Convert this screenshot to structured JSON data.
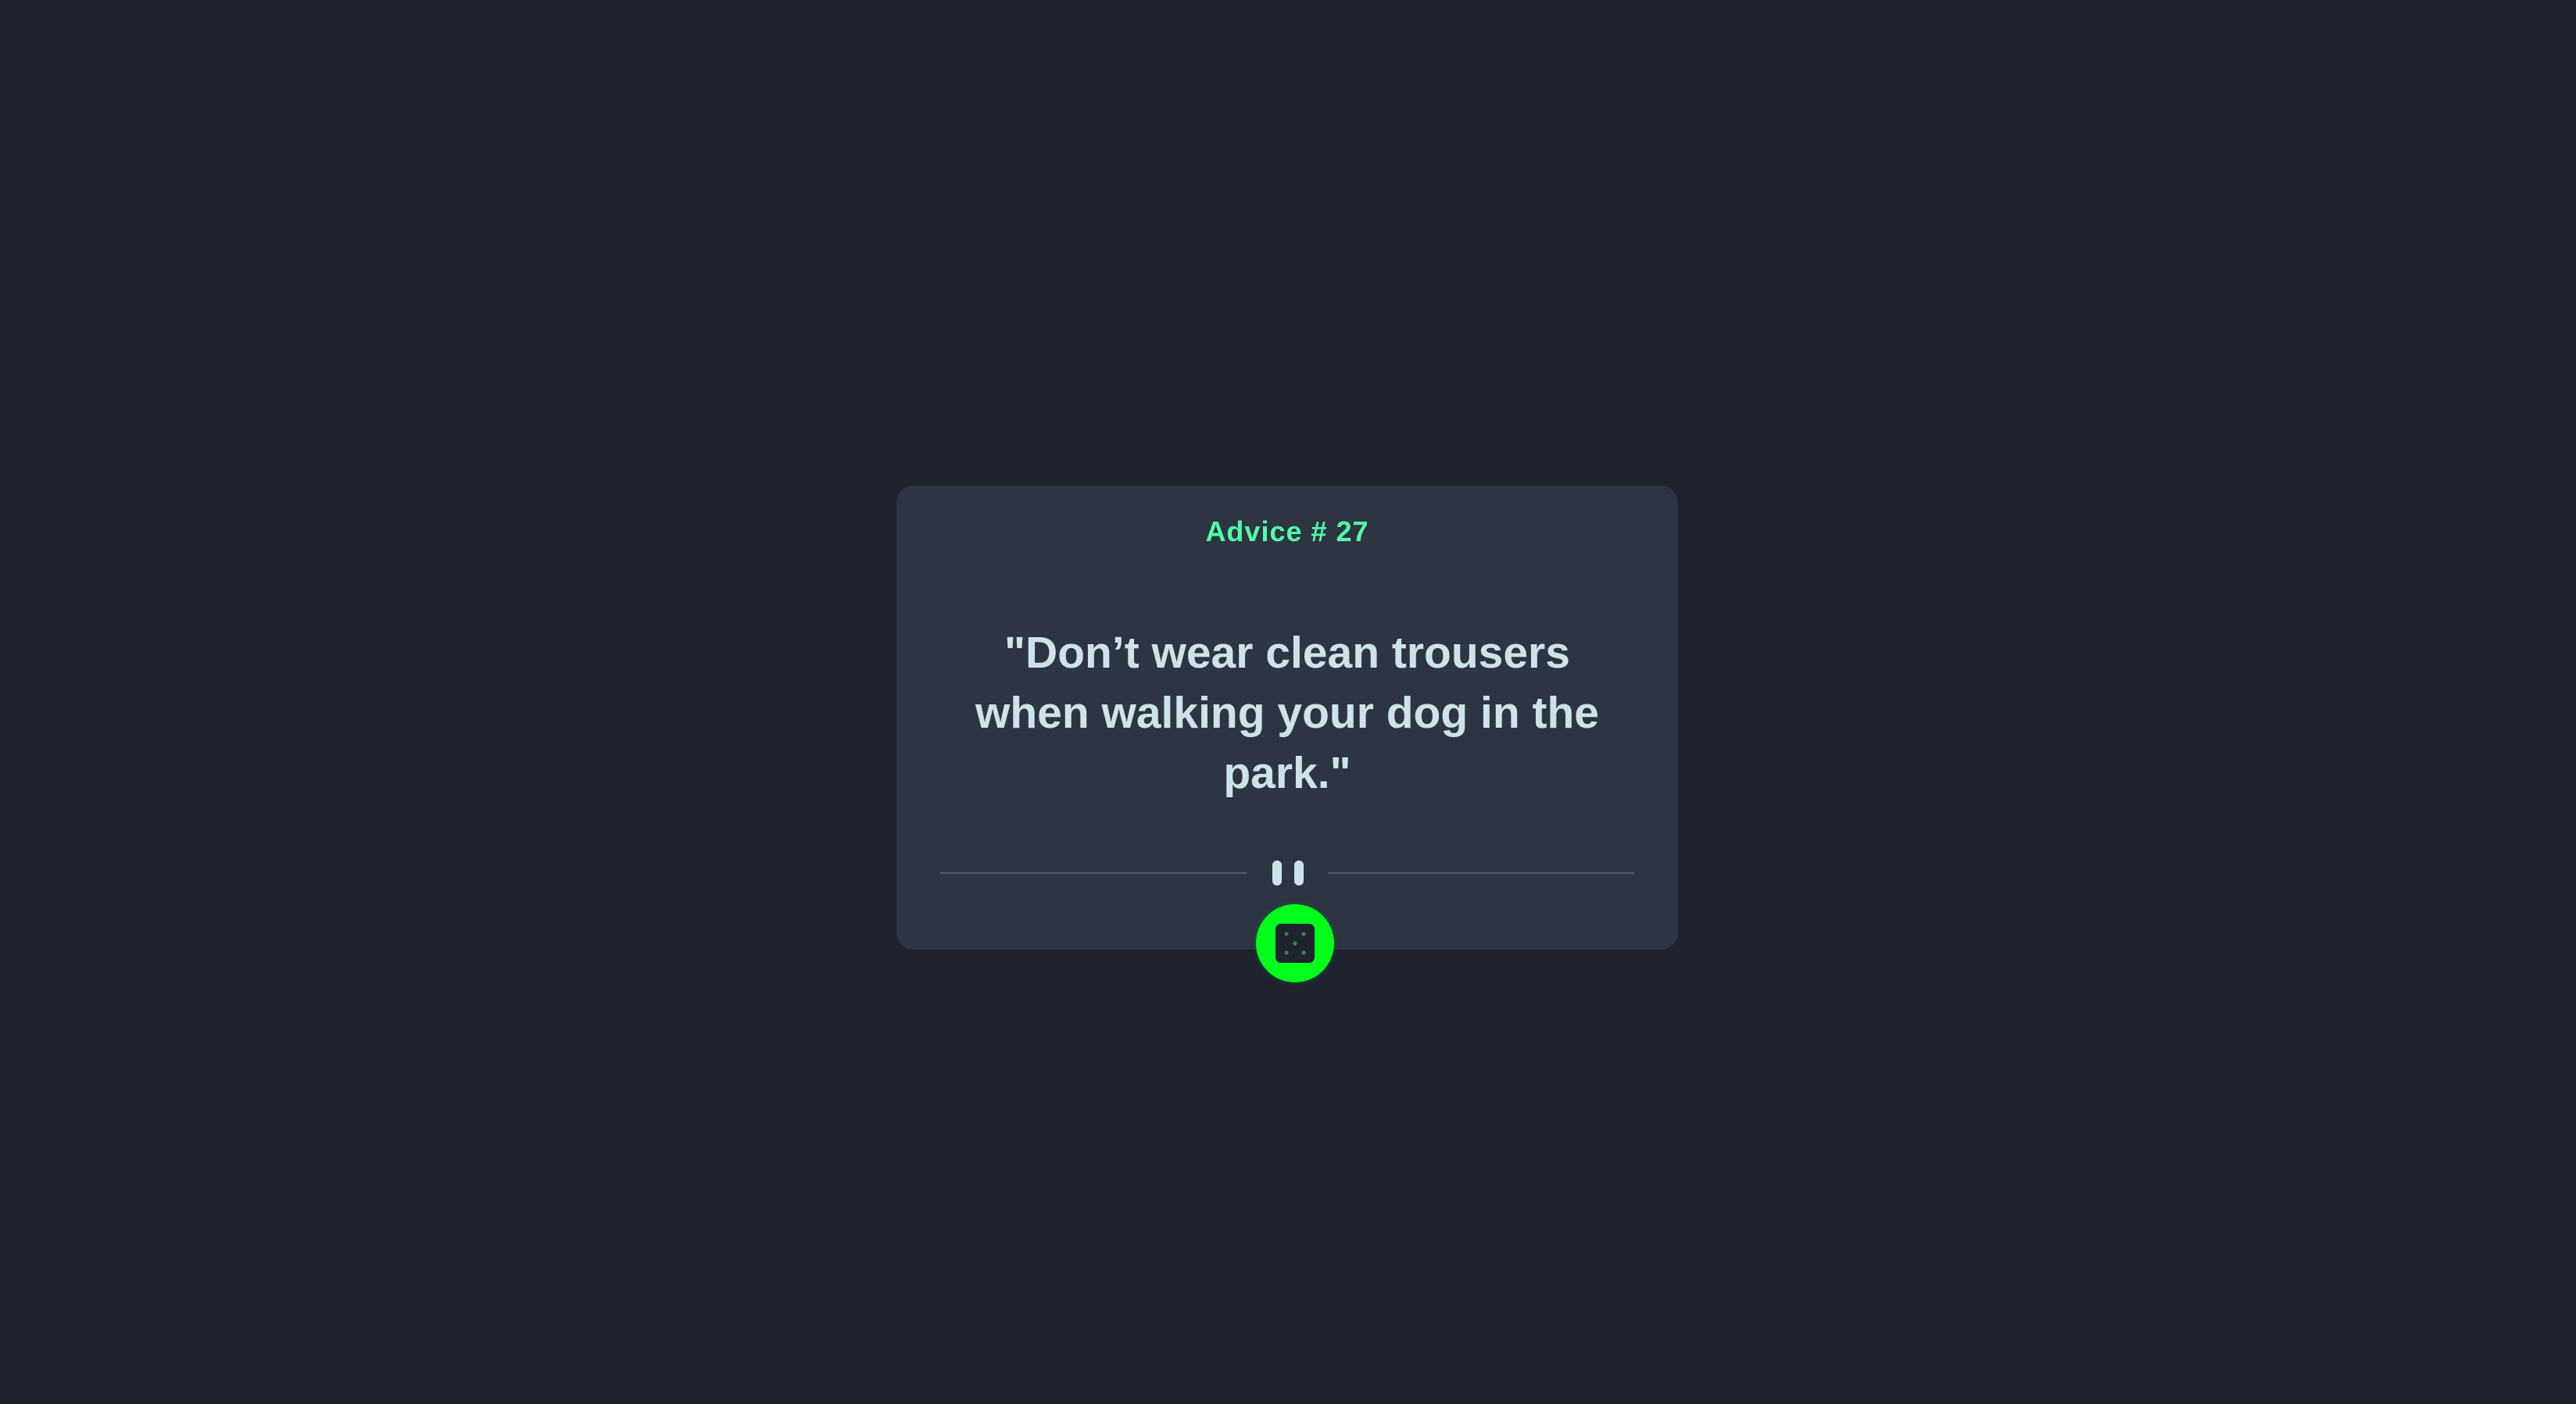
{
  "card": {
    "advice_label": "Advice # 27",
    "quote": "\"Don’t wear clean trousers when walking your dog in the park.\""
  },
  "icons": {
    "divider": "pause-icon",
    "button": "dice-icon"
  },
  "colors": {
    "background": "#1f2330",
    "card": "#2d3542",
    "accent_text": "#52ffa8",
    "quote_text": "#cee3e9",
    "button": "#00ff1a"
  }
}
